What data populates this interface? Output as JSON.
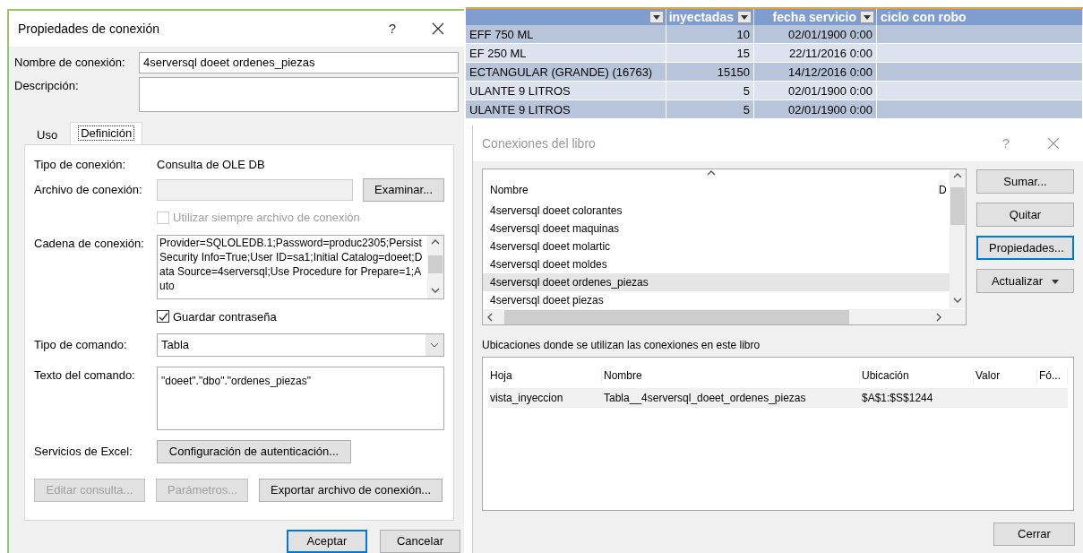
{
  "spreadsheet": {
    "columns": [
      {
        "filter": true
      },
      {
        "label": "inyectadas",
        "filter": true
      },
      {
        "label": "fecha servicio",
        "filter": true
      },
      {
        "label": "ciclo con robo",
        "filter": false
      }
    ],
    "rows": [
      [
        "EFF 750 ML",
        "10",
        "02/01/1900 0:00"
      ],
      [
        "EF 250 ML",
        "15",
        "22/11/2016 0:00"
      ],
      [
        "ECTANGULAR (GRANDE) (16763)",
        "15150",
        "14/12/2016 0:00"
      ],
      [
        "ULANTE 9 LITROS",
        "5",
        "02/01/1900 0:00"
      ],
      [
        "ULANTE 9 LITROS",
        "5",
        "02/01/1900 0:00"
      ]
    ]
  },
  "connection_properties": {
    "title": "Propiedades de conexión",
    "help": "?",
    "name_label": "Nombre de conexión:",
    "name_value": "4serversql doeet ordenes_piezas",
    "description_label": "Descripción:",
    "tabs": [
      {
        "label": "Uso",
        "selected": false
      },
      {
        "label": "Definición",
        "selected": true
      }
    ],
    "connection_type_label": "Tipo de conexión:",
    "connection_type": "Consulta de OLE DB",
    "file_label": "Archivo de conexión:",
    "browse_button": "Examinar...",
    "always_use_file": {
      "label": "Utilizar siempre archivo de conexión",
      "checked": false,
      "disabled": true
    },
    "connection_string_label": "Cadena de conexión:",
    "connection_string": "Provider=SQLOLEDB.1;Password=produc2305;Persist Security Info=True;User ID=sa1;Initial Catalog=doeet;Data Source=4serversql;Use Procedure for Prepare=1;Auto",
    "save_password": {
      "label": "Guardar contraseña",
      "checked": true,
      "disabled": false
    },
    "command_type_label": "Tipo de comando:",
    "command_type": "Tabla",
    "command_text_label": "Texto del comando:",
    "command_text": "\"doeet\".\"dbo\".\"ordenes_piezas\"",
    "excel_services_label": "Servicios de Excel:",
    "auth_button": "Configuración de autenticación...",
    "action_buttons": [
      {
        "label": "Editar consulta...",
        "disabled": true
      },
      {
        "label": "Parámetros...",
        "disabled": true
      },
      {
        "label": "Exportar archivo de conexión...",
        "disabled": false
      }
    ],
    "footer_buttons": [
      {
        "label": "Aceptar",
        "default": true
      },
      {
        "label": "Cancelar",
        "default": false
      }
    ]
  },
  "workbook_connections": {
    "title": "Conexiones del libro",
    "help": "?",
    "list_columns": [
      "Nombre",
      "D"
    ],
    "connections": [
      {
        "name": "4serversql doeet colorantes",
        "selected": false
      },
      {
        "name": "4serversql doeet maquinas",
        "selected": false
      },
      {
        "name": "4serversql doeet molartic",
        "selected": false
      },
      {
        "name": "4serversql doeet moldes",
        "selected": false
      },
      {
        "name": "4serversql doeet ordenes_piezas",
        "selected": true
      },
      {
        "name": "4serversql doeet piezas",
        "selected": false
      }
    ],
    "side_buttons": [
      {
        "label": "Sumar...",
        "default": false,
        "dropdown": false
      },
      {
        "label": "Quitar",
        "default": false,
        "dropdown": false
      },
      {
        "label": "Propiedades...",
        "default": true,
        "dropdown": false
      },
      {
        "label": "Actualizar",
        "default": false,
        "dropdown": true
      }
    ],
    "locations_label": "Ubicaciones donde se utilizan las conexiones en este libro",
    "locations_columns": [
      "Hoja",
      "Nombre",
      "Ubicación",
      "Valor",
      "Fó..."
    ],
    "locations_rows": [
      {
        "cells": [
          "vista_inyeccion",
          "Tabla__4serversql_doeet_ordenes_piezas",
          "$A$1:$S$1244",
          "",
          ""
        ],
        "selected": true
      }
    ],
    "close_button": "Cerrar"
  }
}
